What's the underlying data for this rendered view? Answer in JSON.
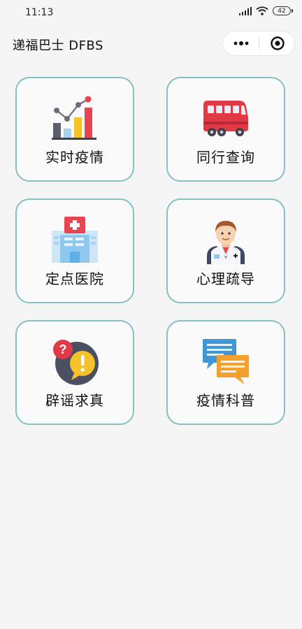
{
  "status_bar": {
    "time": "11:13",
    "battery": "42"
  },
  "nav": {
    "title": "递福巴士 DFBS"
  },
  "menu": [
    {
      "label": "实时疫情",
      "icon": "bar-chart-icon"
    },
    {
      "label": "同行查询",
      "icon": "bus-icon"
    },
    {
      "label": "定点医院",
      "icon": "hospital-icon"
    },
    {
      "label": "心理疏导",
      "icon": "doctor-icon"
    },
    {
      "label": "辟谣求真",
      "icon": "question-alert-icon"
    },
    {
      "label": "疫情科普",
      "icon": "chat-bubbles-icon"
    }
  ],
  "colors": {
    "card_border": "#86c1c1",
    "background": "#f5f5f5"
  }
}
